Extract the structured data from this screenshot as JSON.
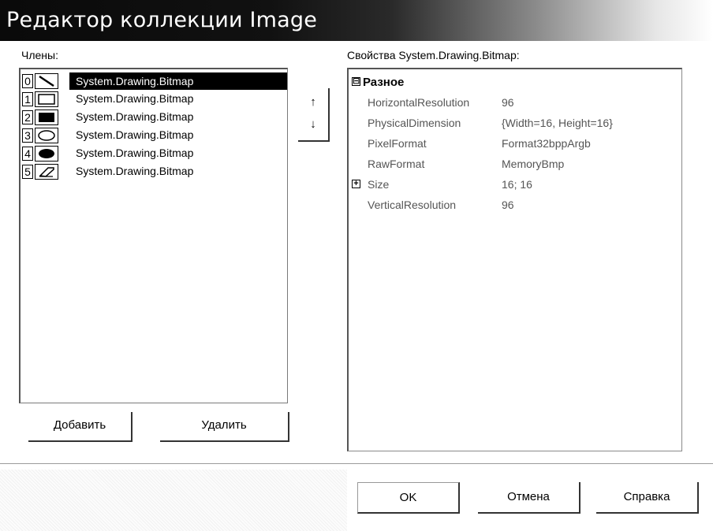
{
  "window": {
    "title": "Редактор коллекции Image"
  },
  "members": {
    "label": "Члены:",
    "items": [
      {
        "index": "0",
        "label": "System.Drawing.Bitmap",
        "icon": "diagonal-line-icon",
        "selected": true
      },
      {
        "index": "1",
        "label": "System.Drawing.Bitmap",
        "icon": "rectangle-outline-icon",
        "selected": false
      },
      {
        "index": "2",
        "label": "System.Drawing.Bitmap",
        "icon": "filled-rectangle-icon",
        "selected": false
      },
      {
        "index": "3",
        "label": "System.Drawing.Bitmap",
        "icon": "ellipse-outline-icon",
        "selected": false
      },
      {
        "index": "4",
        "label": "System.Drawing.Bitmap",
        "icon": "filled-ellipse-icon",
        "selected": false
      },
      {
        "index": "5",
        "label": "System.Drawing.Bitmap",
        "icon": "eraser-icon",
        "selected": false
      }
    ],
    "add_label": "Добавить",
    "remove_label": "Удалить",
    "up_label": "↑",
    "down_label": "↓"
  },
  "properties": {
    "label": "Свойства System.Drawing.Bitmap:",
    "category": "Разное",
    "category_expander": "⊟",
    "rows": [
      {
        "name": "HorizontalResolution",
        "value": "96"
      },
      {
        "name": "PhysicalDimension",
        "value": "{Width=16, Height=16}"
      },
      {
        "name": "PixelFormat",
        "value": "Format32bppArgb"
      },
      {
        "name": "RawFormat",
        "value": "MemoryBmp"
      },
      {
        "name": "Size",
        "value": "16; 16",
        "expandable": true
      },
      {
        "name": "VerticalResolution",
        "value": "96"
      }
    ],
    "size_expander": "+"
  },
  "buttons": {
    "ok": "OK",
    "cancel": "Отмена",
    "help": "Справка"
  }
}
